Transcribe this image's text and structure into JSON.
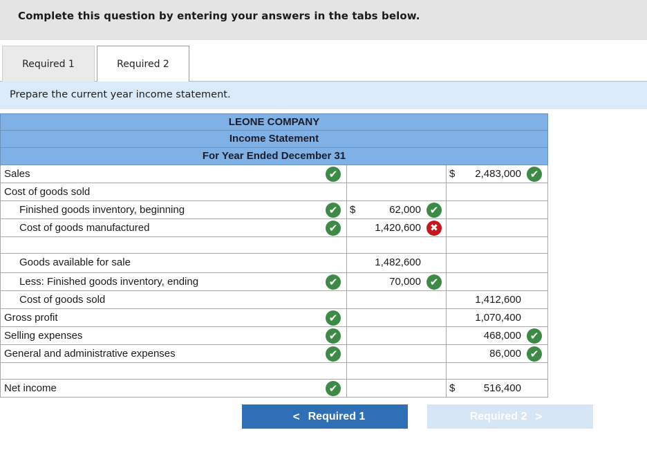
{
  "banner": {
    "text": "Complete this question by entering your answers in the tabs below."
  },
  "tabs": [
    {
      "label": "Required 1",
      "active": false
    },
    {
      "label": "Required 2",
      "active": true
    }
  ],
  "instruction": "Prepare the current year income statement.",
  "statement": {
    "company": "LEONE COMPANY",
    "title": "Income Statement",
    "period": "For Year Ended December 31",
    "rows": [
      {
        "label": "Sales",
        "indent": 0,
        "label_status": "correct",
        "col2": "",
        "col2_dollar": "",
        "col2_status": "",
        "col3": "2,483,000",
        "col3_dollar": "$",
        "col3_status": "correct"
      },
      {
        "label": "Cost of goods sold",
        "indent": 0,
        "label_status": "",
        "col2": "",
        "col2_dollar": "",
        "col2_status": "",
        "col3": "",
        "col3_dollar": "",
        "col3_status": ""
      },
      {
        "label": "Finished goods inventory, beginning",
        "indent": 1,
        "label_status": "correct",
        "col2": "62,000",
        "col2_dollar": "$",
        "col2_status": "correct",
        "col3": "",
        "col3_dollar": "",
        "col3_status": ""
      },
      {
        "label": "Cost of goods manufactured",
        "indent": 1,
        "label_status": "correct",
        "col2": "1,420,600",
        "col2_dollar": "",
        "col2_status": "incorrect",
        "col3": "",
        "col3_dollar": "",
        "col3_status": ""
      },
      {
        "label": "",
        "indent": 0,
        "label_status": "",
        "col2": "",
        "col2_dollar": "",
        "col2_status": "",
        "col3": "",
        "col3_dollar": "",
        "col3_status": ""
      },
      {
        "label": "Goods available for sale",
        "indent": 1,
        "label_status": "",
        "col2": "1,482,600",
        "col2_dollar": "",
        "col2_status": "",
        "col3": "",
        "col3_dollar": "",
        "col3_status": ""
      },
      {
        "label": "Less: Finished goods inventory, ending",
        "indent": 1,
        "label_status": "correct",
        "col2": "70,000",
        "col2_dollar": "",
        "col2_status": "correct",
        "col3": "",
        "col3_dollar": "",
        "col3_status": ""
      },
      {
        "label": "Cost of goods sold",
        "indent": 1,
        "label_status": "",
        "col2": "",
        "col2_dollar": "",
        "col2_status": "",
        "col3": "1,412,600",
        "col3_dollar": "",
        "col3_status": ""
      },
      {
        "label": "Gross profit",
        "indent": 0,
        "label_status": "correct",
        "col2": "",
        "col2_dollar": "",
        "col2_status": "",
        "col3": "1,070,400",
        "col3_dollar": "",
        "col3_status": ""
      },
      {
        "label": "Selling expenses",
        "indent": 0,
        "label_status": "correct",
        "col2": "",
        "col2_dollar": "",
        "col2_status": "",
        "col3": "468,000",
        "col3_dollar": "",
        "col3_status": "correct"
      },
      {
        "label": "General and administrative expenses",
        "indent": 0,
        "label_status": "correct",
        "col2": "",
        "col2_dollar": "",
        "col2_status": "",
        "col3": "86,000",
        "col3_dollar": "",
        "col3_status": "correct"
      },
      {
        "label": "",
        "indent": 0,
        "label_status": "",
        "col2": "",
        "col2_dollar": "",
        "col2_status": "",
        "col3": "",
        "col3_dollar": "",
        "col3_status": ""
      },
      {
        "label": "Net income",
        "indent": 0,
        "label_status": "correct",
        "col2": "",
        "col2_dollar": "",
        "col2_status": "",
        "col3": "516,400",
        "col3_dollar": "$",
        "col3_status": ""
      }
    ]
  },
  "nav": {
    "prev_label": "Required 1",
    "prev_arrow": "<",
    "next_label": "Required 2",
    "next_arrow": ">"
  },
  "icons": {
    "correct": "check-circle-icon",
    "incorrect": "x-circle-icon"
  },
  "colors": {
    "header_blue": "#7fb1e6",
    "correct_green": "#3d8a46",
    "incorrect_red": "#c4161c",
    "button_blue": "#2f6fb6",
    "button_disabled": "#d6e6f4"
  }
}
